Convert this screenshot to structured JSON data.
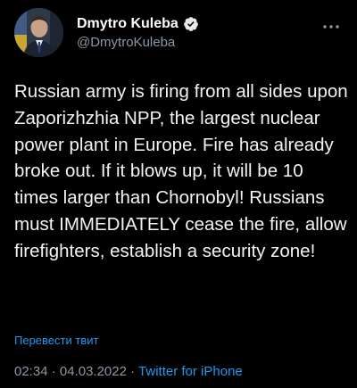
{
  "author": {
    "display_name": "Dmytro Kuleba",
    "handle": "@DmytroKuleba",
    "verified": true
  },
  "tweet": {
    "text": "Russian army is firing from all sides upon Zaporizhzhia NPP, the largest nuclear power plant in Europe. Fire has already broke out. If it blows up, it will be 10 times larger than Chornobyl! Russians must IMMEDIATELY cease the fire, allow firefighters, establish a security zone!",
    "translate_label": "Перевести твит",
    "time": "02:34",
    "date": "04.03.2022",
    "separator": "·",
    "source": "Twitter for iPhone"
  },
  "icons": {
    "avatar": "avatar-photo",
    "verified": "verified-badge-icon",
    "more": "more-options-icon"
  },
  "colors": {
    "background": "#000000",
    "text": "#e7e9ea",
    "secondary": "#8b98a5",
    "accent": "#1d9bf0"
  }
}
